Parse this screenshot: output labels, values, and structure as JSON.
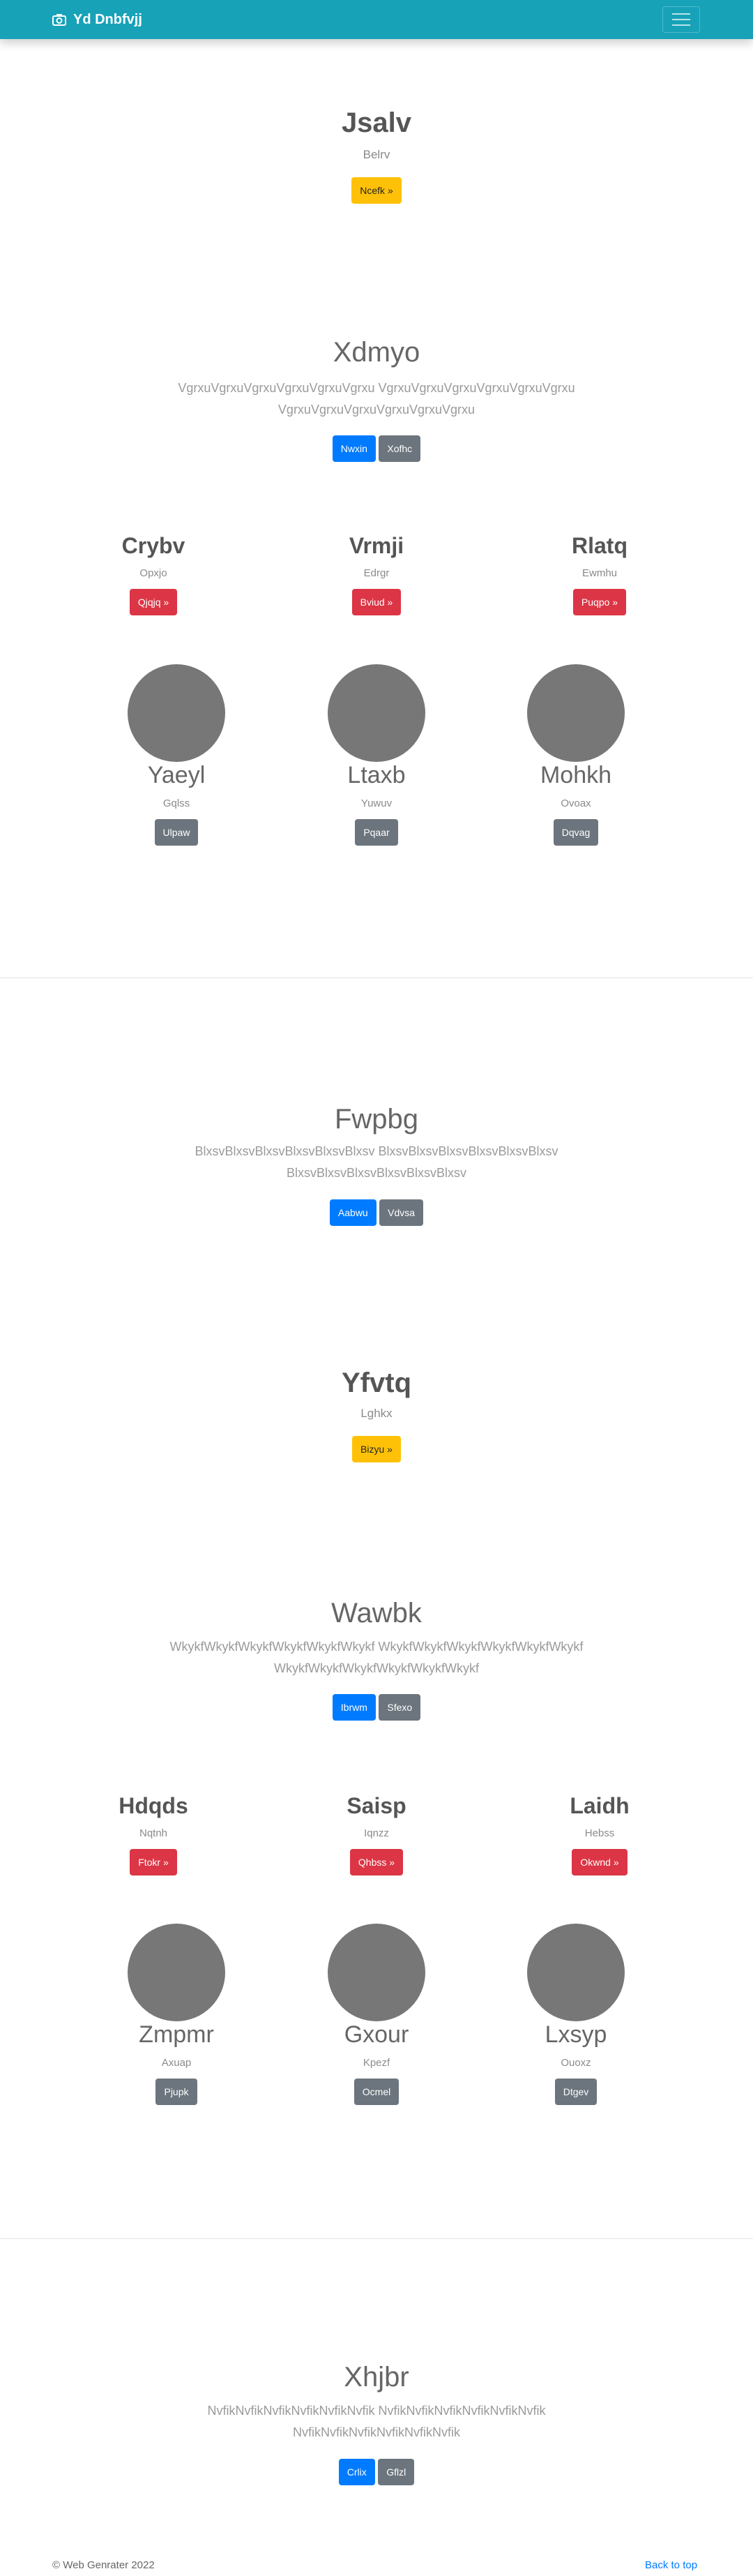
{
  "nav": {
    "brand": "Yd Dnbfvjj"
  },
  "hero1": {
    "title": "Jsalv",
    "subtitle": "Belrv",
    "button": "Ncefk »"
  },
  "section1": {
    "title": "Xdmyo",
    "text_line1": "VgrxuVgrxuVgrxuVgrxuVgrxuVgrxu VgrxuVgrxuVgrxuVgrxuVgrxuVgrxu",
    "text_line2": "VgrxuVgrxuVgrxuVgrxuVgrxuVgrxu",
    "btn_primary": "Nwxin",
    "btn_secondary": "Xofhc"
  },
  "features1": [
    {
      "title": "Crybv",
      "text": "Opxjo",
      "button": "Qjqjq »"
    },
    {
      "title": "Vrmji",
      "text": "Edrgr",
      "button": "Bviud »"
    },
    {
      "title": "Rlatq",
      "text": "Ewmhu",
      "button": "Puqpo »"
    }
  ],
  "people1": [
    {
      "name": "Yaeyl",
      "text": "Gqlss",
      "button": "Ulpaw"
    },
    {
      "name": "Ltaxb",
      "text": "Yuwuv",
      "button": "Pqaar"
    },
    {
      "name": "Mohkh",
      "text": "Ovoax",
      "button": "Dqvag"
    }
  ],
  "section2": {
    "title": "Fwpbg",
    "text_line1": "BlxsvBlxsvBlxsvBlxsvBlxsvBlxsv BlxsvBlxsvBlxsvBlxsvBlxsvBlxsv",
    "text_line2": "BlxsvBlxsvBlxsvBlxsvBlxsvBlxsv",
    "btn_primary": "Aabwu",
    "btn_secondary": "Vdvsa"
  },
  "hero2": {
    "title": "Yfvtq",
    "subtitle": "Lghkx",
    "button": "Bizyu »"
  },
  "section3": {
    "title": "Wawbk",
    "text_line1": "WkykfWkykfWkykfWkykfWkykfWkykf WkykfWkykfWkykfWkykfWkykfWkykf",
    "text_line2": "WkykfWkykfWkykfWkykfWkykfWkykf",
    "btn_primary": "Ibrwm",
    "btn_secondary": "Sfexo"
  },
  "features2": [
    {
      "title": "Hdqds",
      "text": "Nqtnh",
      "button": "Ftokr »"
    },
    {
      "title": "Saisp",
      "text": "Iqnzz",
      "button": "Qhbss »"
    },
    {
      "title": "Laidh",
      "text": "Hebss",
      "button": "Okwnd »"
    }
  ],
  "people2": [
    {
      "name": "Zmpmr",
      "text": "Axuap",
      "button": "Pjupk"
    },
    {
      "name": "Gxour",
      "text": "Kpezf",
      "button": "Ocmel"
    },
    {
      "name": "Lxsyp",
      "text": "Ouoxz",
      "button": "Dtgev"
    }
  ],
  "section4": {
    "title": "Xhjbr",
    "text_line1": "NvfikNvfikNvfikNvfikNvfikNvfik NvfikNvfikNvfikNvfikNvfikNvfik",
    "text_line2": "NvfikNvfikNvfikNvfikNvfikNvfik",
    "btn_primary": "Crlix",
    "btn_secondary": "Gflzl"
  },
  "footer": {
    "copyright": "© Web Genrater 2022",
    "back_to_top": "Back to top"
  },
  "icons": {
    "brand": "camera-icon",
    "toggler": "menu-icon"
  },
  "colors": {
    "navbar": "#17a2b8",
    "warning": "#ffc107",
    "primary": "#007bff",
    "secondary": "#6c757d",
    "danger": "#dc3545",
    "avatar": "#777777"
  }
}
